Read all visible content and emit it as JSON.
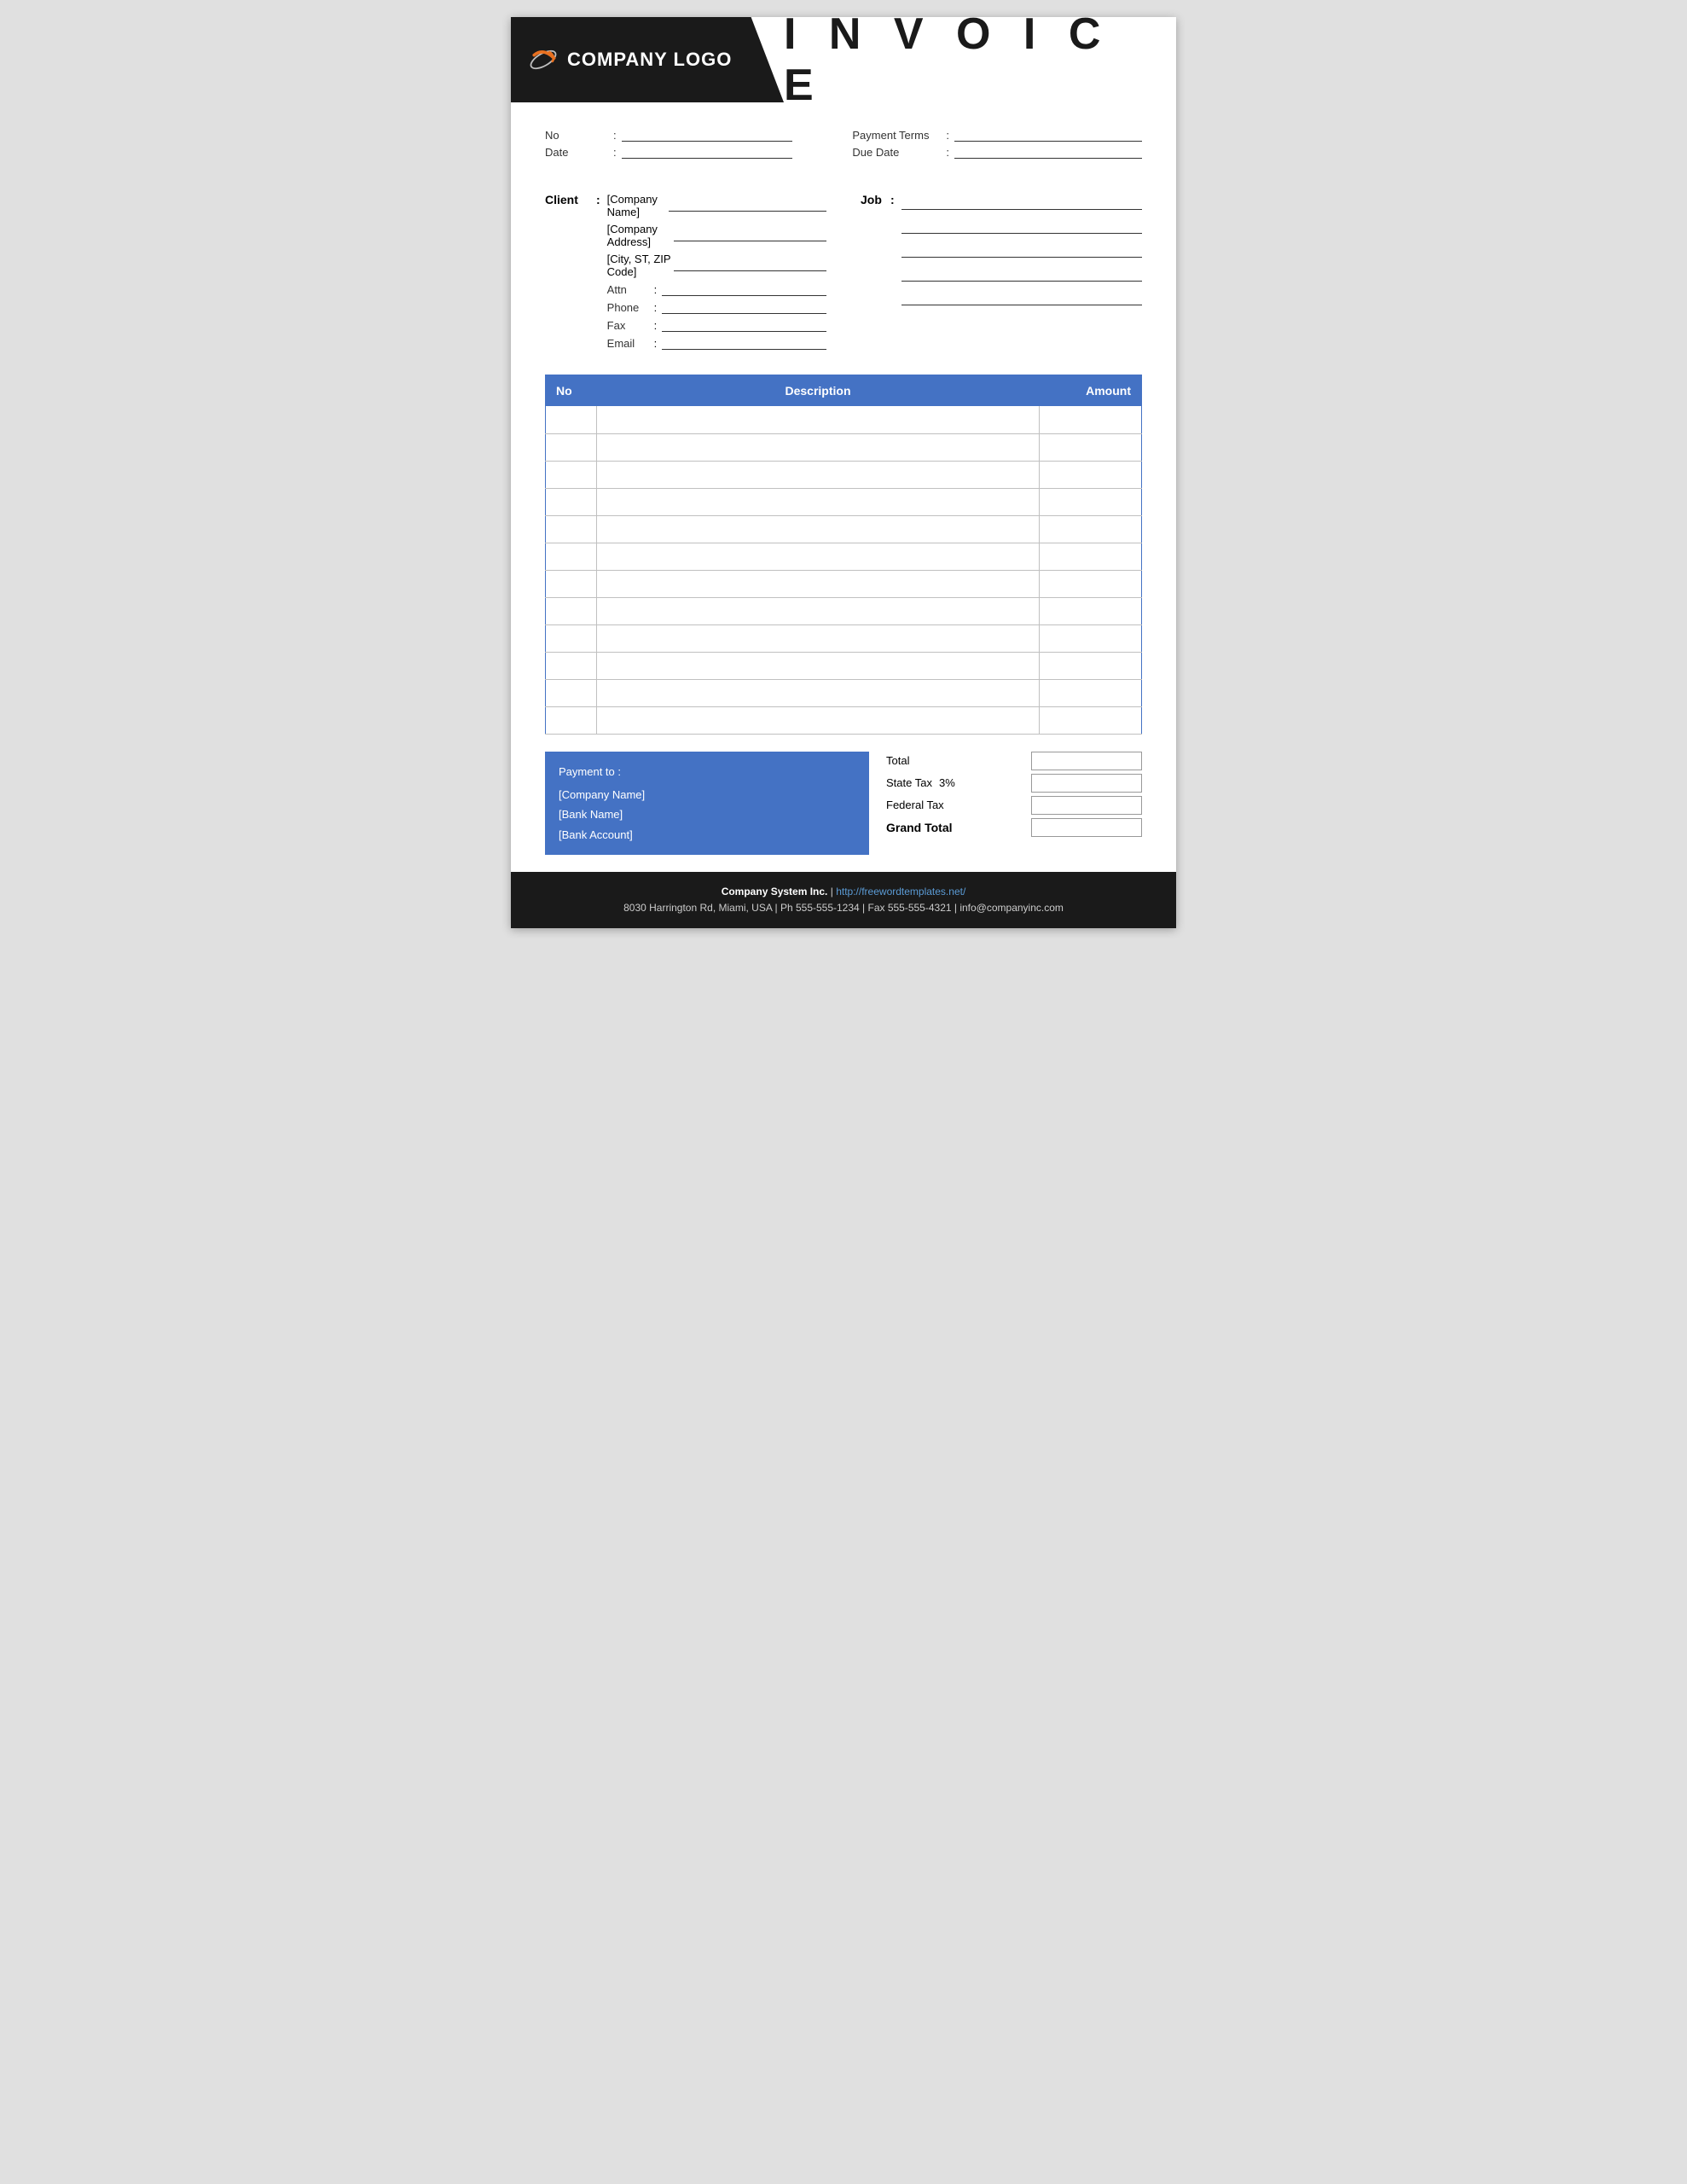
{
  "header": {
    "logo_text": "COMPANY LOGO",
    "invoice_title": "I N V O I C E"
  },
  "invoice_info": {
    "no_label": "No",
    "no_colon": ":",
    "payment_terms_label": "Payment  Terms",
    "payment_terms_colon": ":",
    "date_label": "Date",
    "date_colon": ":",
    "due_date_label": "Due Date",
    "due_date_colon": ":"
  },
  "client": {
    "label": "Client",
    "colon": ":",
    "company_name": "[Company Name]",
    "company_address": "[Company Address]",
    "city_zip": "[City, ST, ZIP Code]",
    "attn_label": "Attn",
    "attn_colon": ":",
    "phone_label": "Phone",
    "phone_colon": ":",
    "fax_label": "Fax",
    "fax_colon": ":",
    "email_label": "Email",
    "email_colon": ":"
  },
  "job": {
    "label": "Job",
    "colon": ":"
  },
  "table": {
    "col_no": "No",
    "col_description": "Description",
    "col_amount": "Amount",
    "rows": [
      {
        "no": "",
        "description": "",
        "amount": ""
      },
      {
        "no": "",
        "description": "",
        "amount": ""
      },
      {
        "no": "",
        "description": "",
        "amount": ""
      },
      {
        "no": "",
        "description": "",
        "amount": ""
      },
      {
        "no": "",
        "description": "",
        "amount": ""
      },
      {
        "no": "",
        "description": "",
        "amount": ""
      },
      {
        "no": "",
        "description": "",
        "amount": ""
      },
      {
        "no": "",
        "description": "",
        "amount": ""
      },
      {
        "no": "",
        "description": "",
        "amount": ""
      },
      {
        "no": "",
        "description": "",
        "amount": ""
      },
      {
        "no": "",
        "description": "",
        "amount": ""
      },
      {
        "no": "",
        "description": "",
        "amount": ""
      }
    ]
  },
  "payment": {
    "label": "Payment to :",
    "company_name": "[Company Name]",
    "bank_name": "[Bank Name]",
    "bank_account": "[Bank Account]"
  },
  "totals": {
    "total_label": "Total",
    "state_tax_label": "State Tax",
    "state_tax_rate": "3%",
    "federal_tax_label": "Federal Tax",
    "grand_total_label": "Grand Total"
  },
  "footer": {
    "company": "Company System Inc.",
    "separator": "|",
    "website": "http://freewordtemplates.net/",
    "address": "8030 Harrington Rd, Miami, USA | Ph 555-555-1234 | Fax 555-555-4321 | info@companyinc.com"
  }
}
